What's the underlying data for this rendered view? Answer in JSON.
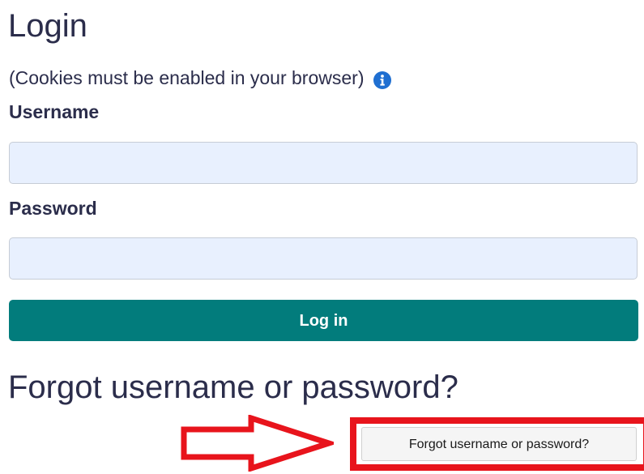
{
  "login": {
    "title": "Login",
    "cookies_note": "(Cookies must be enabled in your browser)",
    "info_icon": "info-circle-icon"
  },
  "form": {
    "username_label": "Username",
    "username_value": "",
    "password_label": "Password",
    "password_value": "",
    "login_button": "Log in"
  },
  "forgot": {
    "heading": "Forgot username or password?",
    "button_label": "Forgot username or password?"
  },
  "annotation": {
    "arrow_icon": "right-arrow-outline-icon",
    "highlight_color": "#e8141c"
  },
  "colors": {
    "text": "#2b2d4b",
    "button": "#027c7c",
    "input_bg": "#e8f0fe",
    "info_icon": "#1f6fd1"
  }
}
